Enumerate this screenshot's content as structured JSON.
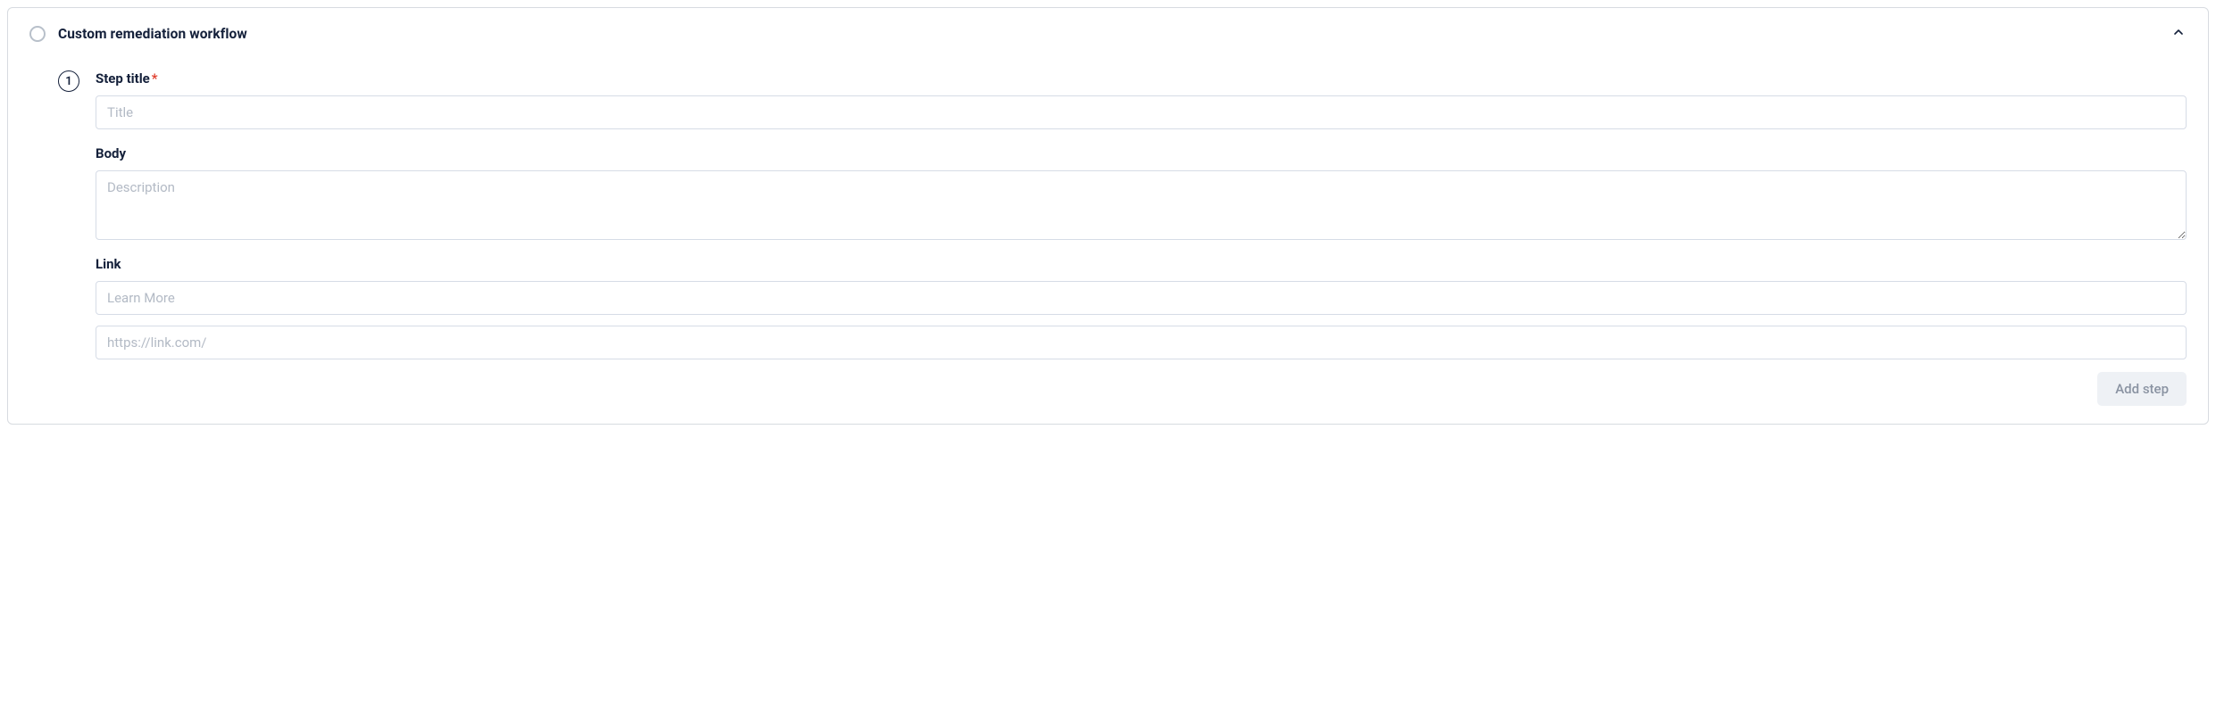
{
  "panel": {
    "title": "Custom remediation workflow"
  },
  "step": {
    "number": "1",
    "title_label": "Step title",
    "title_placeholder": "Title",
    "body_label": "Body",
    "body_placeholder": "Description",
    "link_label": "Link",
    "link_text_placeholder": "Learn More",
    "link_url_placeholder": "https://link.com/"
  },
  "actions": {
    "add_step": "Add step"
  }
}
